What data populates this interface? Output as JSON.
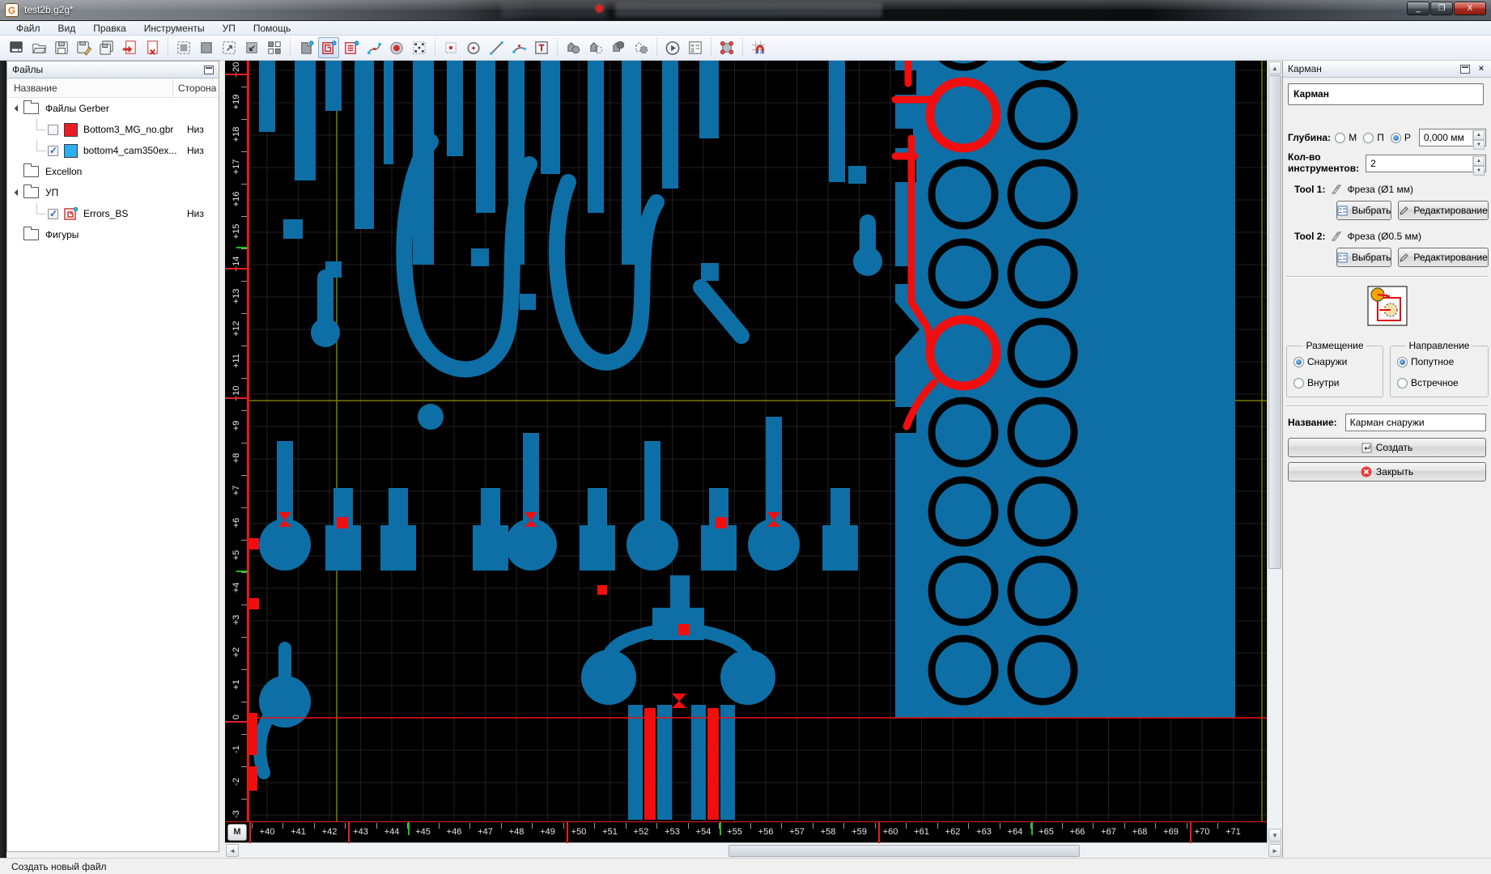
{
  "window": {
    "title": "test2b.g2g*",
    "minimize_label": "_",
    "maximize_label": "❐",
    "close_label": "X"
  },
  "menu": {
    "items": [
      "Файл",
      "Вид",
      "Правка",
      "Инструменты",
      "УП",
      "Помощь"
    ]
  },
  "toolbar": {
    "groups": [
      [
        {
          "id": "new-file",
          "name": "new-file"
        },
        {
          "id": "open-file",
          "name": "open-file"
        },
        {
          "id": "save",
          "name": "save"
        },
        {
          "id": "save-as",
          "name": "save-as"
        },
        {
          "id": "save-all",
          "name": "save-all"
        },
        {
          "id": "import-file",
          "name": "import-file"
        },
        {
          "id": "close-file",
          "name": "close-file"
        }
      ],
      [
        {
          "id": "select-all",
          "name": "select-all"
        },
        {
          "id": "select-region",
          "name": "select-region"
        },
        {
          "id": "zoom-window",
          "name": "zoom-window"
        },
        {
          "id": "zoom-fit",
          "name": "zoom-fit"
        },
        {
          "id": "tile-view",
          "name": "tile-view"
        }
      ],
      [
        {
          "id": "mill-contour",
          "name": "mill-contour"
        },
        {
          "id": "mill-pocket",
          "name": "mill-pocket",
          "active": true
        },
        {
          "id": "mill-hatch",
          "name": "mill-hatch"
        },
        {
          "id": "mill-curve",
          "name": "mill-curve"
        },
        {
          "id": "drill",
          "name": "drill"
        },
        {
          "id": "drill-pattern",
          "name": "drill-pattern"
        }
      ],
      [
        {
          "id": "draw-point",
          "name": "draw-point"
        },
        {
          "id": "draw-circle",
          "name": "draw-circle"
        },
        {
          "id": "draw-line",
          "name": "draw-line"
        },
        {
          "id": "draw-arc",
          "name": "draw-arc"
        },
        {
          "id": "draw-text",
          "name": "draw-text"
        }
      ],
      [
        {
          "id": "bool-union",
          "name": "bool-union"
        },
        {
          "id": "bool-subtract",
          "name": "bool-subtract"
        },
        {
          "id": "bool-intersect",
          "name": "bool-intersect"
        },
        {
          "id": "bool-xor",
          "name": "bool-xor"
        }
      ],
      [
        {
          "id": "run-program",
          "name": "run-program"
        },
        {
          "id": "program-params",
          "name": "program-params"
        }
      ],
      [
        {
          "id": "transform-points",
          "name": "transform-points"
        }
      ],
      [
        {
          "id": "snap-grid",
          "name": "snap-grid"
        }
      ]
    ]
  },
  "files_panel": {
    "title": "Файлы",
    "columns": [
      "Название",
      "Сторона"
    ],
    "tree": [
      {
        "label": "Файлы Gerber",
        "type": "folder",
        "expanded": true,
        "level": 0
      },
      {
        "label": "Bottom3_MG_no.gbr",
        "type": "file",
        "checked": false,
        "swatch": "#ec1c24",
        "side": "Низ",
        "level": 1
      },
      {
        "label": "bottom4_cam350ex...",
        "type": "file",
        "checked": true,
        "swatch": "#29aef0",
        "side": "Низ",
        "level": 1
      },
      {
        "label": "Excellon",
        "type": "folder",
        "expanded": false,
        "level": 0
      },
      {
        "label": "УП",
        "type": "folder",
        "expanded": true,
        "level": 0
      },
      {
        "label": "Errors_BS",
        "type": "program",
        "checked": true,
        "side": "Низ",
        "level": 1
      },
      {
        "label": "Фигуры",
        "type": "folder",
        "expanded": false,
        "level": 0
      }
    ]
  },
  "pocket_panel": {
    "header": "Карман",
    "name_value": "Карман",
    "depth": {
      "label": "Глубина:",
      "options": [
        "М",
        "П",
        "Р"
      ],
      "selected": "Р",
      "value": "0,000 мм"
    },
    "tools_count": {
      "label_line1": "Кол-во",
      "label_line2": "инструментов:",
      "value": "2"
    },
    "tools": [
      {
        "label": "Tool 1:",
        "desc": "Фреза (Ø1 мм)"
      },
      {
        "label": "Tool 2:",
        "desc": "Фреза (Ø0.5 мм)"
      }
    ],
    "select_btn": "Выбрать",
    "edit_btn": "Редактирование",
    "placement": {
      "label": "Размещение",
      "options": [
        "Снаружи",
        "Внутри"
      ],
      "selected": "Снаружи"
    },
    "direction": {
      "label": "Направление",
      "options": [
        "Попутное",
        "Встречное"
      ],
      "selected": "Попутное"
    },
    "name_label": "Название:",
    "name_field": "Карман снаружи",
    "create_btn": "Создать",
    "close_btn": "Закрыть"
  },
  "canvas": {
    "m_button": "M",
    "h_ruler": [
      "+40",
      "+41",
      "+42",
      "+43",
      "+44",
      "+45",
      "+46",
      "+47",
      "+48",
      "+49",
      "+50",
      "+51",
      "+52",
      "+53",
      "+54",
      "+55",
      "+56",
      "+57",
      "+58",
      "+59",
      "+60",
      "+61",
      "+62",
      "+63",
      "+64",
      "+65",
      "+66",
      "+67",
      "+68",
      "+69",
      "+70",
      "+71"
    ],
    "v_ruler": [
      "+20",
      "+19",
      "+18",
      "+17",
      "+16",
      "+15",
      "+14",
      "+13",
      "+12",
      "+11",
      "+10",
      "+9",
      "+8",
      "+7",
      "+6",
      "+5",
      "+4",
      "+3",
      "+2",
      "+1",
      "0",
      "-1",
      "-2",
      "-3"
    ],
    "colors": {
      "trace": "#0e6fa6",
      "error": "#f10e0e",
      "grid": "#6e6e6e",
      "outline": "#7c7c00",
      "background": "#000000"
    }
  },
  "status_bar": {
    "text": "Создать новый файл"
  }
}
